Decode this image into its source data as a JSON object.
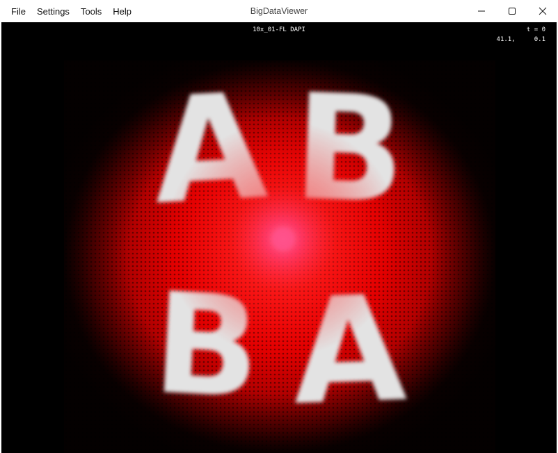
{
  "window": {
    "title": "BigDataViewer"
  },
  "menu": {
    "items": [
      {
        "label": "File"
      },
      {
        "label": "Settings"
      },
      {
        "label": "Tools"
      },
      {
        "label": "Help"
      }
    ]
  },
  "window_controls": {
    "minimize_icon": "minimize-icon",
    "maximize_icon": "maximize-icon",
    "close_icon": "close-icon"
  },
  "viewer": {
    "source_name": "10x_01-FL DAPI",
    "timepoint_label": "t = 0",
    "coordinates_x": "41.1,",
    "coordinates_y": "0.1",
    "image": {
      "letters": [
        "A",
        "B",
        "B",
        "A"
      ],
      "background_color": "#000000",
      "tissue_color": "#ff0000",
      "letter_color": "#e8e8e8",
      "center_glow_color": "#ff3b6b"
    }
  }
}
